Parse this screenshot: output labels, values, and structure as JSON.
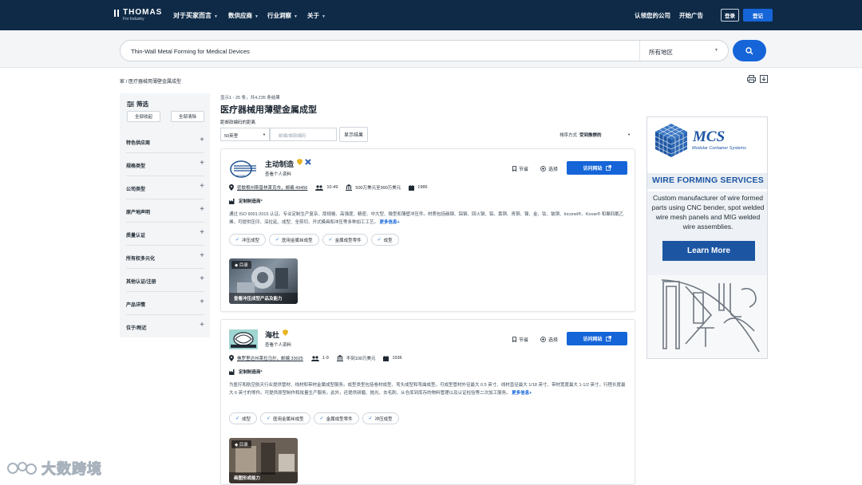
{
  "nav": {
    "logo_word": "THOMAS",
    "logo_sub": "For Industry",
    "links": [
      "对于买家而言",
      "数供应商",
      "行业洞察",
      "关于"
    ],
    "verify": "认领您的公司",
    "advertise": "开始广告",
    "login": "登录",
    "register": "登记"
  },
  "search": {
    "query": "Thin-Wall Metal Forming for Medical Devices",
    "region": "所有地区"
  },
  "breadcrumb": "家 / 医疗器械用薄壁金属成型",
  "results": {
    "count": "显示1 - 25 条，共4,235 条结果",
    "title": "医疗器械用薄壁金属成型",
    "distance_label": "距邮政编码的距离",
    "distance_value": "50英里",
    "zip_placeholder": "邮编/邮政编码",
    "show_results": "显示结果",
    "sort_label": "排序方式",
    "sort_value": "受到推崇的"
  },
  "filters": {
    "heading": "筛选",
    "expand_all": "全部收起",
    "clear_all": "全部清除",
    "items": [
      "特色供应商",
      "规格类型",
      "公司类型",
      "原产地声明",
      "质量认证",
      "所有权多元化",
      "其他认证/注册",
      "产品详情",
      "位于/附近"
    ]
  },
  "cards": [
    {
      "name": "主动制造",
      "profile": "查看个人资料",
      "save": "节省",
      "select": "选择",
      "visit": "访问网站",
      "address": "密歇根州斯普林莱克市，邮编 49456",
      "employees": "10-49",
      "revenue": "500万美元至990万美元",
      "founded": "1986",
      "tag": "定制制造商*",
      "description": "通过 ISO 9001:2015 认证。专业定制生产复杂、厚规格、高强度、精密、中大型、微型和薄壁冲压件。材质包括碳钢、铝钢、回火钢、铝、黄铜、青铜、镍、金、钛、铍铜、Inconel®、Kovar® 和聚四氟乙烯。可提供压印、深拉延、成型、全剪切、开式模具和冲压等多种加工工艺。",
      "more": "更多信息+",
      "chips": [
        "冲压成型",
        "医用金属丝成型",
        "金属成型零件",
        "成型"
      ],
      "catalog_label": "目录",
      "catalog_caption": "查看冲压成型产品及能力"
    },
    {
      "name": "海杜",
      "profile": "查看个人资料",
      "save": "节省",
      "select": "选择",
      "visit": "访问网站",
      "address": "佛罗里达州莱拉马尔，邮编 33025",
      "employees": "1-9",
      "revenue": "不到100万美元",
      "founded": "1936",
      "tag": "定制制造商*",
      "description": "为医疗和航空航天行业提供管材、线材和带材金属成型服务。成型类型包括卷材成型、弯头成型和弯曲成型。可成型管材外径最大 0.5 英寸、线材直径最大 1/18 英寸、带材宽度最大 1-1/2 英寸，行程长度最大 6 英寸的零件。可提供原型制作和批量生产服务。此外，还提供研磨、抛光、去毛刺、从仓库到库存的物料管理以及认证检验等二次加工服务。",
      "more": "更多信息+",
      "chips": [
        "成型",
        "医用金属丝成型",
        "金属成型零件",
        "冲压成型"
      ],
      "catalog_label": "目录",
      "catalog_caption": "画图形成能力"
    }
  ],
  "ad": {
    "logo": "MCS",
    "logo_sub": "Modular Container Systems",
    "heading": "WIRE FORMING SERVICES",
    "body": "Custom manufacturer of wire formed parts using CNC bender, spot welded wire mesh panels and MIG welded wire assemblies.",
    "button": "Learn More",
    "accent": "#1c56a3"
  },
  "watermark": "大数跨境",
  "colors": {
    "nav_bg": "#0e2a47",
    "primary": "#1565d8"
  }
}
